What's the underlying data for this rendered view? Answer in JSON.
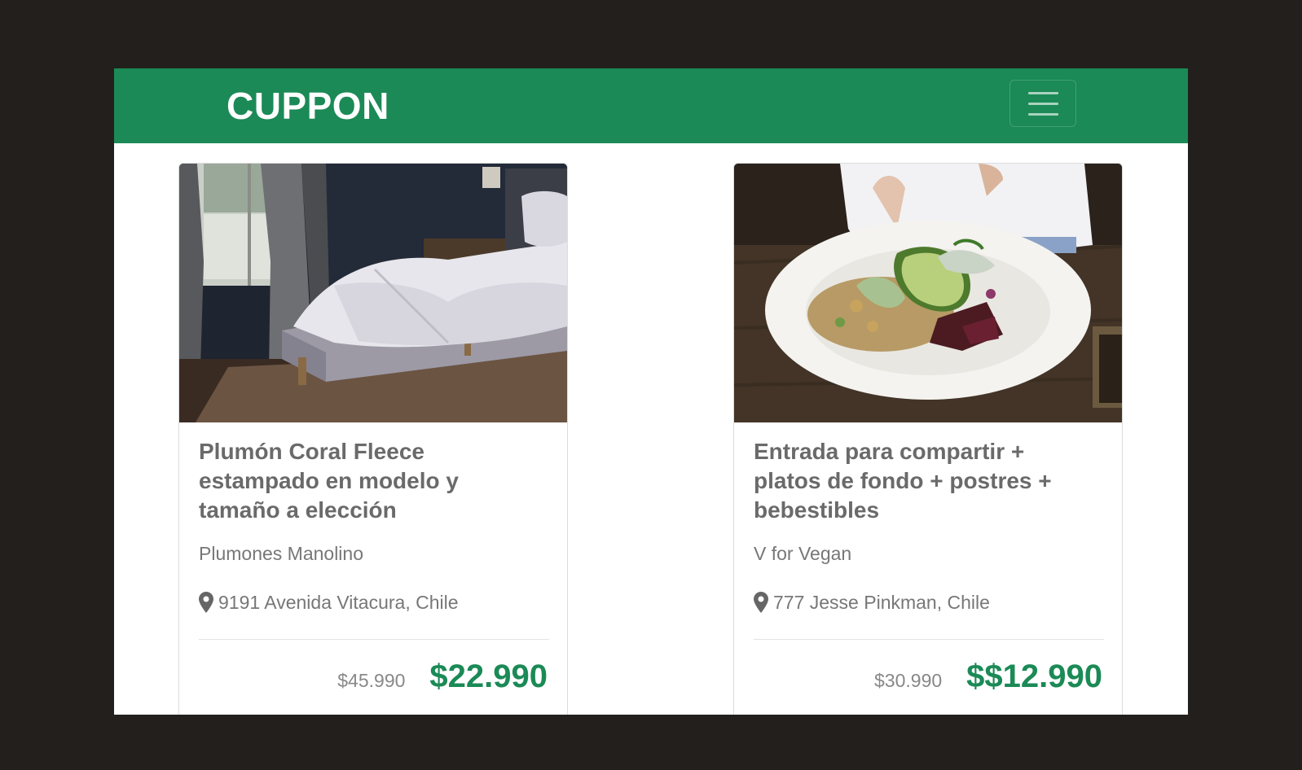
{
  "navbar": {
    "brand": "CUPPON",
    "brand_color": "#1b8a56"
  },
  "cards": [
    {
      "title": "Plumón Coral Fleece estampado en modelo y tamaño a elección",
      "vendor": "Plumones Manolino",
      "location": "9191 Avenida Vitacura, Chile",
      "old_price": "$45.990",
      "new_price": "$22.990",
      "image": "bedroom-bed-photo"
    },
    {
      "title": "Entrada para compartir + platos de fondo + postres + bebestibles",
      "vendor": "V for Vegan",
      "location": "777 Jesse Pinkman, Chile",
      "old_price": "$30.990",
      "new_price": "$$12.990",
      "image": "vegan-salad-bowl-photo"
    }
  ],
  "icons": {
    "menu": "hamburger-menu-icon",
    "location": "map-pin-icon"
  }
}
